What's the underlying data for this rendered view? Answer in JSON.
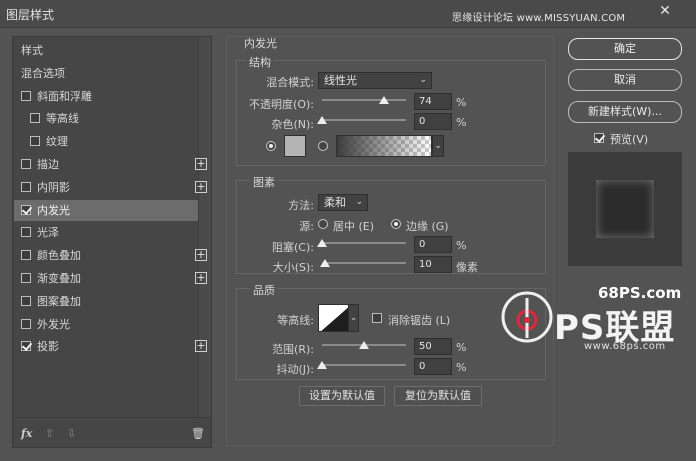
{
  "window": {
    "title": "图层样式",
    "watermark": "思缘设计论坛 www.MISSYUAN.COM",
    "close_glyph": "✕"
  },
  "style_list": {
    "items": [
      {
        "label": "样式",
        "checkbox": false,
        "checked": false,
        "plus": false,
        "sub": false,
        "selected": false
      },
      {
        "label": "混合选项",
        "checkbox": false,
        "checked": false,
        "plus": false,
        "sub": false,
        "selected": false
      },
      {
        "label": "斜面和浮雕",
        "checkbox": true,
        "checked": false,
        "plus": false,
        "sub": false,
        "selected": false
      },
      {
        "label": "等高线",
        "checkbox": true,
        "checked": false,
        "plus": false,
        "sub": true,
        "selected": false
      },
      {
        "label": "纹理",
        "checkbox": true,
        "checked": false,
        "plus": false,
        "sub": true,
        "selected": false
      },
      {
        "label": "描边",
        "checkbox": true,
        "checked": false,
        "plus": true,
        "sub": false,
        "selected": false
      },
      {
        "label": "内阴影",
        "checkbox": true,
        "checked": false,
        "plus": true,
        "sub": false,
        "selected": false
      },
      {
        "label": "内发光",
        "checkbox": true,
        "checked": true,
        "plus": false,
        "sub": false,
        "selected": true
      },
      {
        "label": "光泽",
        "checkbox": true,
        "checked": false,
        "plus": false,
        "sub": false,
        "selected": false
      },
      {
        "label": "颜色叠加",
        "checkbox": true,
        "checked": false,
        "plus": true,
        "sub": false,
        "selected": false
      },
      {
        "label": "渐变叠加",
        "checkbox": true,
        "checked": false,
        "plus": true,
        "sub": false,
        "selected": false
      },
      {
        "label": "图案叠加",
        "checkbox": true,
        "checked": false,
        "plus": false,
        "sub": false,
        "selected": false
      },
      {
        "label": "外发光",
        "checkbox": true,
        "checked": false,
        "plus": false,
        "sub": false,
        "selected": false
      },
      {
        "label": "投影",
        "checkbox": true,
        "checked": true,
        "plus": true,
        "sub": false,
        "selected": false
      }
    ],
    "toolbar": {
      "fx": "fx",
      "up": "⇧",
      "down": "⇩",
      "trash": "🗑"
    }
  },
  "panel": {
    "title": "内发光",
    "structure": {
      "title": "结构",
      "blend_mode_label": "混合模式:",
      "blend_mode_value": "线性光",
      "opacity_label": "不透明度(O):",
      "opacity_value": "74",
      "opacity": 74,
      "noise_label": "杂色(N):",
      "noise_value": "0",
      "noise": 0,
      "unit": "%"
    },
    "elements": {
      "title": "图素",
      "method_label": "方法:",
      "method_value": "柔和",
      "source_label": "源:",
      "source_center": "居中 (E)",
      "source_edge": "边缘 (G)",
      "choke_label": "阻塞(C):",
      "choke_value": "0",
      "choke": 0,
      "size_label": "大小(S):",
      "size_value": "10",
      "size": 10,
      "size_unit": "像素",
      "unit": "%"
    },
    "quality": {
      "title": "品质",
      "contour_label": "等高线:",
      "antialias_label": "消除锯齿 (L)",
      "range_label": "范围(R):",
      "range_value": "50",
      "range": 50,
      "jitter_label": "抖动(J):",
      "jitter_value": "0",
      "jitter": 0,
      "unit": "%"
    },
    "buttons": {
      "make_default": "设置为默认值",
      "reset_default": "复位为默认值"
    }
  },
  "right": {
    "ok": "确定",
    "cancel": "取消",
    "new_style": "新建样式(W)...",
    "preview_label": "预览(V)",
    "preview_checked": true
  },
  "logo": {
    "site": "68PS.com",
    "brand": "PS联盟",
    "url": "www.68ps.com"
  },
  "colors": {
    "accent": "#e8233c",
    "bg": "#535353"
  }
}
